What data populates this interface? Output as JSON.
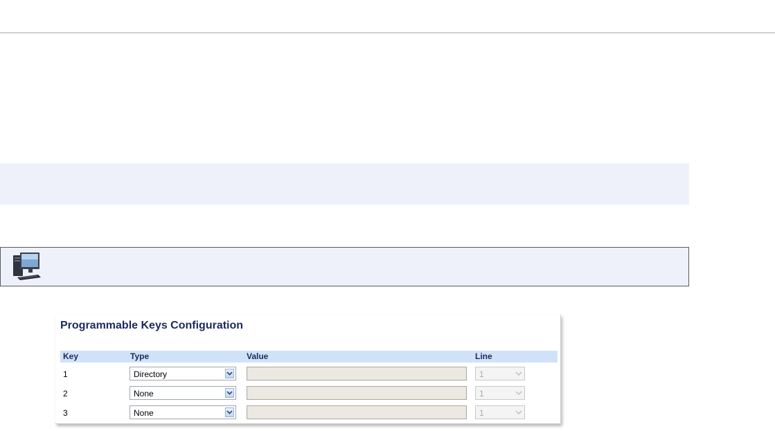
{
  "config": {
    "title": "Programmable Keys Configuration",
    "columns": {
      "key": "Key",
      "type": "Type",
      "value": "Value",
      "line": "Line"
    },
    "rows": [
      {
        "key": "1",
        "type": "Directory",
        "value": "",
        "line": "1"
      },
      {
        "key": "2",
        "type": "None",
        "value": "",
        "line": "1"
      },
      {
        "key": "3",
        "type": "None",
        "value": "",
        "line": "1"
      }
    ]
  },
  "colors": {
    "title_text": "#1c2a5c",
    "header_bg": "#cfe2f7",
    "band_bg": "#eef1fa",
    "value_field_bg": "#ece9e2"
  },
  "icons": {
    "note": "desktop-computer-icon",
    "select_arrow": "chevron-down-icon"
  }
}
